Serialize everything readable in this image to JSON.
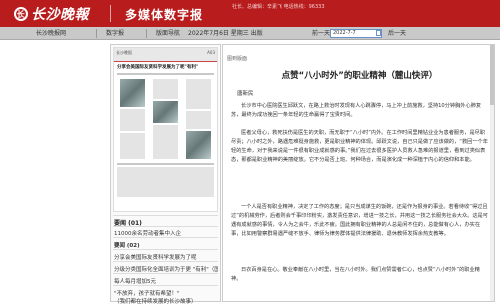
{
  "banner": {
    "logo_text": "长沙晚報",
    "logo_mark": "长",
    "title": "多媒体数字报",
    "info": "社长、总编辑：辛素飞 电话热线：96333"
  },
  "nav": {
    "tabs": [
      "长沙晚报网",
      "数字报",
      "版面导航"
    ],
    "date_text": "2022年7月6日 星期三 出版",
    "prev_label": "前一天",
    "date_input_value": "2022-7-7",
    "next_label": "后一天"
  },
  "thumbnail": {
    "header_left": "长沙晚报",
    "header_right": "A03",
    "headline": "分享会美国际友贤科学发展为了呢\"有利\""
  },
  "left_list": {
    "heading": "要闻 (01)",
    "items": [
      "11000余名劳动者集中入企",
      "要闻 (02)",
      "分享会美国际友贤科学发展为了呢",
      "分级分类国际化全面培训为于更 \"有利\"（国际长沙）",
      "每人每月增加5元",
      "\"不放弃，孩子就有希望！\"",
      "（我们都在持续发展的长沙故事）"
    ]
  },
  "article": {
    "crumb": "图到版面",
    "title": "点赞“八小时外”的职业精神（麓山快评）",
    "author": "唐新民",
    "paragraphs": [
      "长沙市中心医院医生邱跃文，在路上救治时发现有人心跳骤停，马上冲上前施救，坚持10分钟胸外心肺复苏，最终为成功挽回一条年轻的生命赢得了宝贵时间。",
      "医者父母心，救死扶伤是医生的天职，而无职于“八小时”内外。在工作时间里精钻业业为患者服务，是尽职尽责；八小时之外，路遇危难挺身施救，更是职业精神的体现。邱跃文说，自己只是做了应该做的，“救回一个年轻的生命，对于我来说是一件很有职业成就感的事。”我们在过去很多医护人员救人急难的报道里，看到过类似表态，那都是职业精神的美丽绽放。它不分是否上班、何种场合，而是演化成一种深植于内心的信仰和本能。",
      "一个人是否有职业精神，决定了工作的态度；是只当成谋生的饭碗，还是作为报身的事业。若看待收“得过且过”的机械劳作，后者则会千事印印粉实，激发责任意识，增进一技之长，并用这一技之长服务社会大众。这是可遇有成就感的事情，令人为之会牛，乐此不疲。国此拥有职业精神的人总是闲不住的，总能做有心人，办实在事，比如用警察群易遇严缝不放手、律师为律务群体提供法律援助、退休教师发挥余热支教等。",
      "日衣百身是在心。敬业奉献在八小时里，当在八小时外。我们点赞需者仁心，也点赞“八小时外”的职业精神。"
    ]
  }
}
